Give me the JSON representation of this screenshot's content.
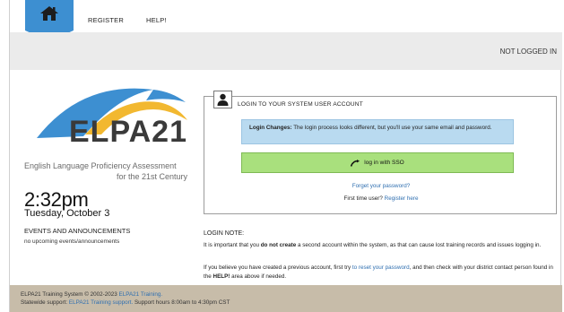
{
  "nav": {
    "register_label": "REGISTER",
    "help_label": "HELP!"
  },
  "status": {
    "not_logged_in": "NOT LOGGED IN"
  },
  "brand": {
    "logo_text": "ELPA21",
    "tagline_line1": "English Language Proficiency Assessment",
    "tagline_line2": "for the 21st Century",
    "colors": {
      "arc_outer": "#3d8fd1",
      "arc_inner": "#f2b830",
      "wordmark": "#3a3a3a"
    }
  },
  "clock": {
    "time": "2:32pm",
    "date": "Tuesday, October 3"
  },
  "events": {
    "heading": "EVENTS AND ANNOUNCEMENTS",
    "empty_text": "no upcoming events/announcements"
  },
  "login": {
    "title": "LOGIN TO YOUR SYSTEM USER ACCOUNT",
    "info_bold": "Login Changes:",
    "info_text": " The login process looks different, but you'll use your same email and password.",
    "sso_label": "log in with SSO",
    "forgot_link": "Forget your password?",
    "first_time_text": "First time user?",
    "register_link": "Register here"
  },
  "note": {
    "heading": "LOGIN NOTE:",
    "p1_pre": "It is important that you ",
    "p1_bold": "do not create",
    "p1_post": " a second account within the system, as that can cause lost training records and issues logging in.",
    "p2_pre": "If you believe you have created a previous account, first try ",
    "p2_link": "to reset your password",
    "p2_mid": ", and then check with your district contact person found in the ",
    "p2_bold": "HELP!",
    "p2_post": " area above if needed."
  },
  "footer": {
    "line1_pre": "ELPA21 Training System © 2002-2023 ",
    "line1_link": "ELPA21 Training.",
    "line2_pre": "Statewide support: ",
    "line2_link": "ELPA21 Training support.",
    "line2_post": " Support hours 8:00am to 4:30pm CST"
  }
}
